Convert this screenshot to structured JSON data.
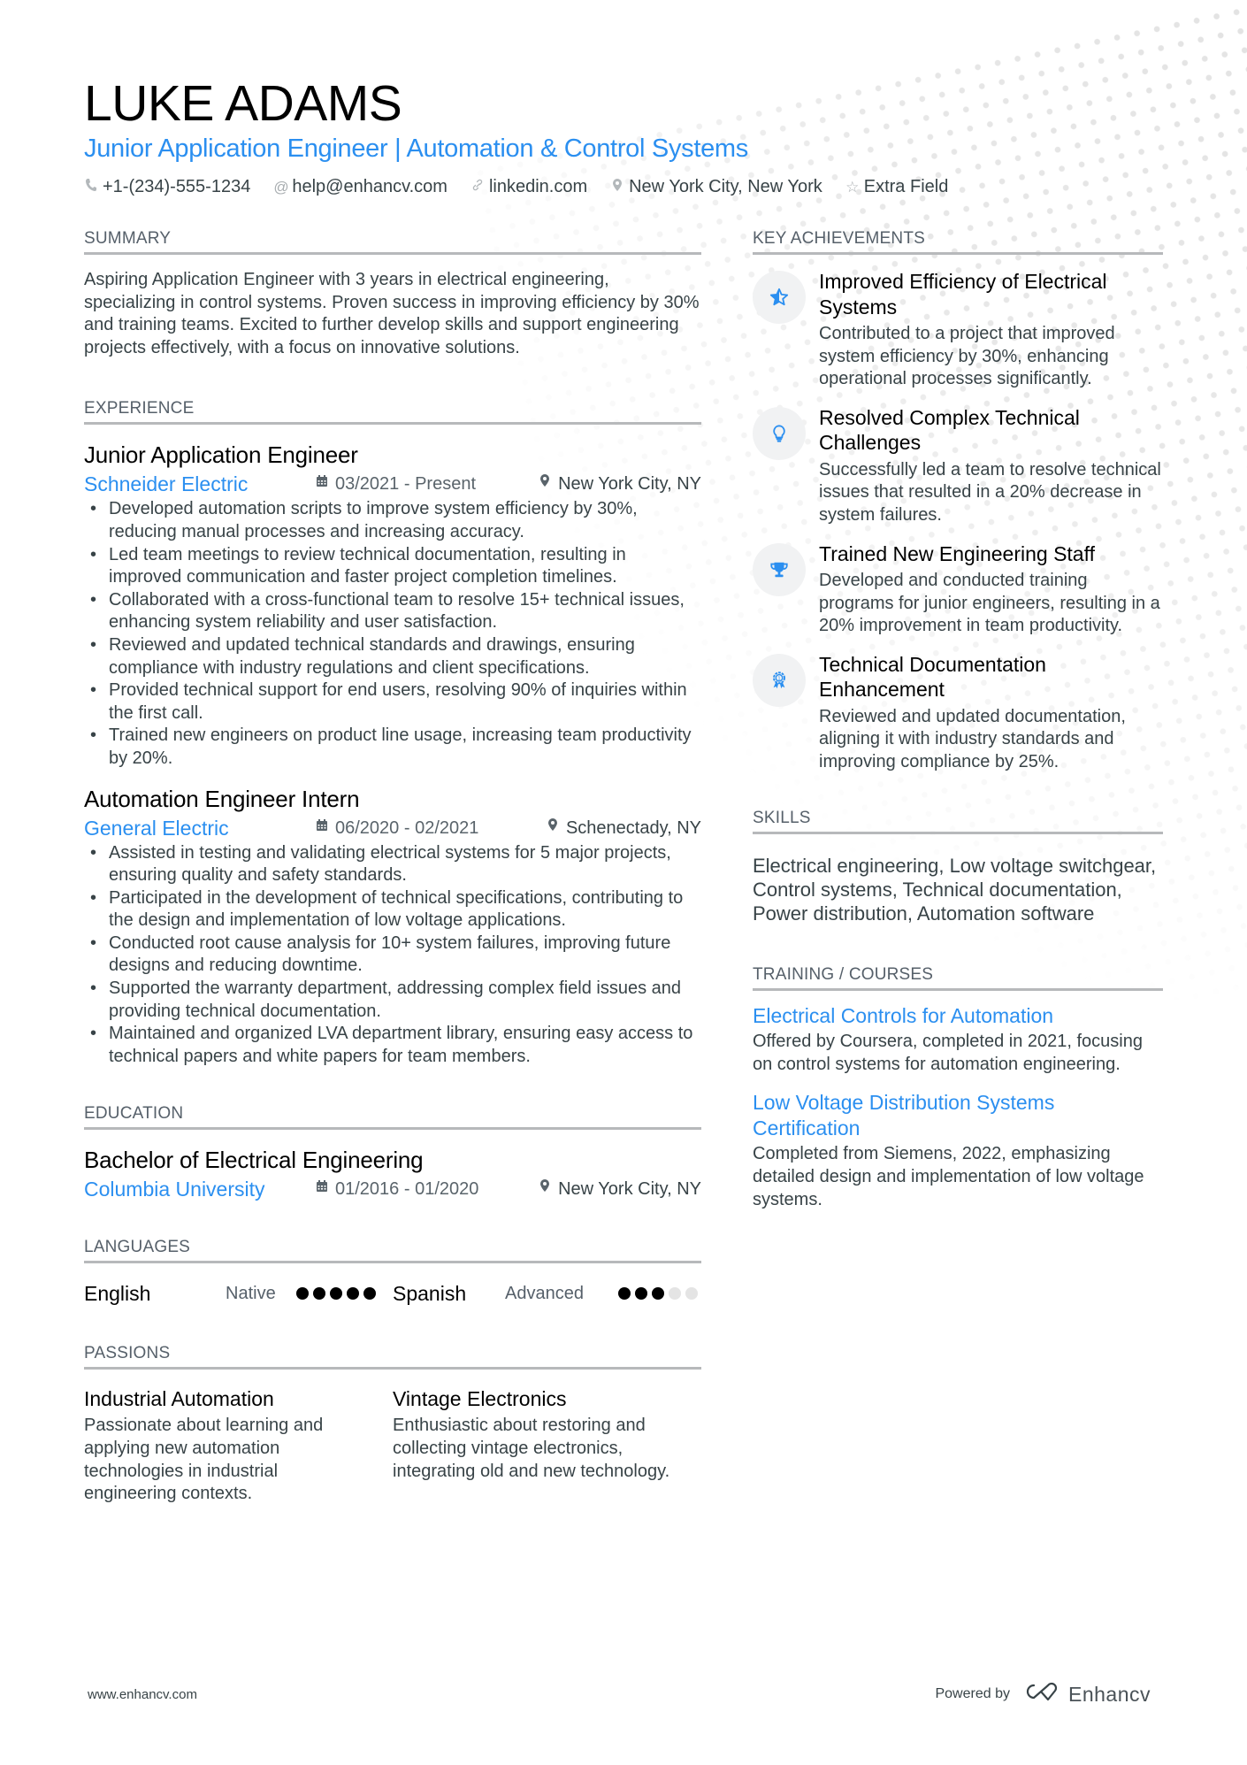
{
  "header": {
    "name": "LUKE ADAMS",
    "title": "Junior Application Engineer | Automation & Control Systems",
    "contacts": [
      {
        "icon": "phone-icon",
        "text": "+1-(234)-555-1234"
      },
      {
        "icon": "at-icon",
        "text": "help@enhancv.com"
      },
      {
        "icon": "link-icon",
        "text": "linkedin.com"
      },
      {
        "icon": "location-pin-icon",
        "text": "New York City, New York"
      },
      {
        "icon": "star-icon",
        "text": "Extra Field"
      }
    ]
  },
  "summary": {
    "heading": "SUMMARY",
    "text": "Aspiring Application Engineer with 3 years in electrical engineering, specializing in control systems. Proven success in improving efficiency by 30% and training teams. Excited to further develop skills and support engineering projects effectively, with a focus on innovative solutions."
  },
  "experience": {
    "heading": "EXPERIENCE",
    "jobs": [
      {
        "title": "Junior Application Engineer",
        "company": "Schneider Electric",
        "dates": "03/2021 - Present",
        "location": "New York City, NY",
        "bullets": [
          "Developed automation scripts to improve system efficiency by 30%, reducing manual processes and increasing accuracy.",
          "Led team meetings to review technical documentation, resulting in improved communication and faster project completion timelines.",
          "Collaborated with a cross-functional team to resolve 15+ technical issues, enhancing system reliability and user satisfaction.",
          "Reviewed and updated technical standards and drawings, ensuring compliance with industry regulations and client specifications.",
          "Provided technical support for end users, resolving 90% of inquiries within the first call.",
          "Trained new engineers on product line usage, increasing team productivity by 20%."
        ]
      },
      {
        "title": "Automation Engineer Intern",
        "company": "General Electric",
        "dates": "06/2020 - 02/2021",
        "location": "Schenectady, NY",
        "bullets": [
          "Assisted in testing and validating electrical systems for 5 major projects, ensuring quality and safety standards.",
          "Participated in the development of technical specifications, contributing to the design and implementation of low voltage applications.",
          "Conducted root cause analysis for 10+ system failures, improving future designs and reducing downtime.",
          "Supported the warranty department, addressing complex field issues and providing technical documentation.",
          "Maintained and organized LVA department library, ensuring easy access to technical papers and white papers for team members."
        ]
      }
    ]
  },
  "education": {
    "heading": "EDUCATION",
    "degree": "Bachelor of Electrical Engineering",
    "school": "Columbia University",
    "dates": "01/2016 - 01/2020",
    "location": "New York City, NY"
  },
  "languages": {
    "heading": "LANGUAGES",
    "items": [
      {
        "name": "English",
        "level": "Native",
        "rating": 5,
        "max": 5
      },
      {
        "name": "Spanish",
        "level": "Advanced",
        "rating": 3,
        "max": 5
      }
    ]
  },
  "passions": {
    "heading": "PASSIONS",
    "items": [
      {
        "title": "Industrial Automation",
        "desc": "Passionate about learning and applying new automation technologies in industrial engineering contexts."
      },
      {
        "title": "Vintage Electronics",
        "desc": "Enthusiastic about restoring and collecting vintage electronics, integrating old and new technology."
      }
    ]
  },
  "achievements": {
    "heading": "KEY ACHIEVEMENTS",
    "items": [
      {
        "icon": "star-half-icon",
        "title": "Improved Efficiency of Electrical Systems",
        "desc": "Contributed to a project that improved system efficiency by 30%, enhancing operational processes significantly."
      },
      {
        "icon": "lightbulb-icon",
        "title": "Resolved Complex Technical Challenges",
        "desc": "Successfully led a team to resolve technical issues that resulted in a 20% decrease in system failures."
      },
      {
        "icon": "trophy-icon",
        "title": "Trained New Engineering Staff",
        "desc": "Developed and conducted training programs for junior engineers, resulting in a 20% improvement in team productivity."
      },
      {
        "icon": "award-medal-icon",
        "title": "Technical Documentation Enhancement",
        "desc": "Reviewed and updated documentation, aligning it with industry standards and improving compliance by 25%."
      }
    ]
  },
  "skills": {
    "heading": "SKILLS",
    "text": "Electrical engineering, Low voltage switchgear, Control systems, Technical documentation, Power distribution, Automation software"
  },
  "training": {
    "heading": "TRAINING / COURSES",
    "items": [
      {
        "title": "Electrical Controls for Automation",
        "desc": "Offered by Coursera, completed in 2021, focusing on control systems for automation engineering."
      },
      {
        "title": "Low Voltage Distribution Systems Certification",
        "desc": "Completed from Siemens, 2022, emphasizing detailed design and implementation of low voltage systems."
      }
    ]
  },
  "footer": {
    "url": "www.enhancv.com",
    "powered_by": "Powered by",
    "brand": "Enhancv"
  },
  "colors": {
    "accent": "#2b8ff0",
    "text": "#384347",
    "heading_rule": "#b7b9bb"
  }
}
